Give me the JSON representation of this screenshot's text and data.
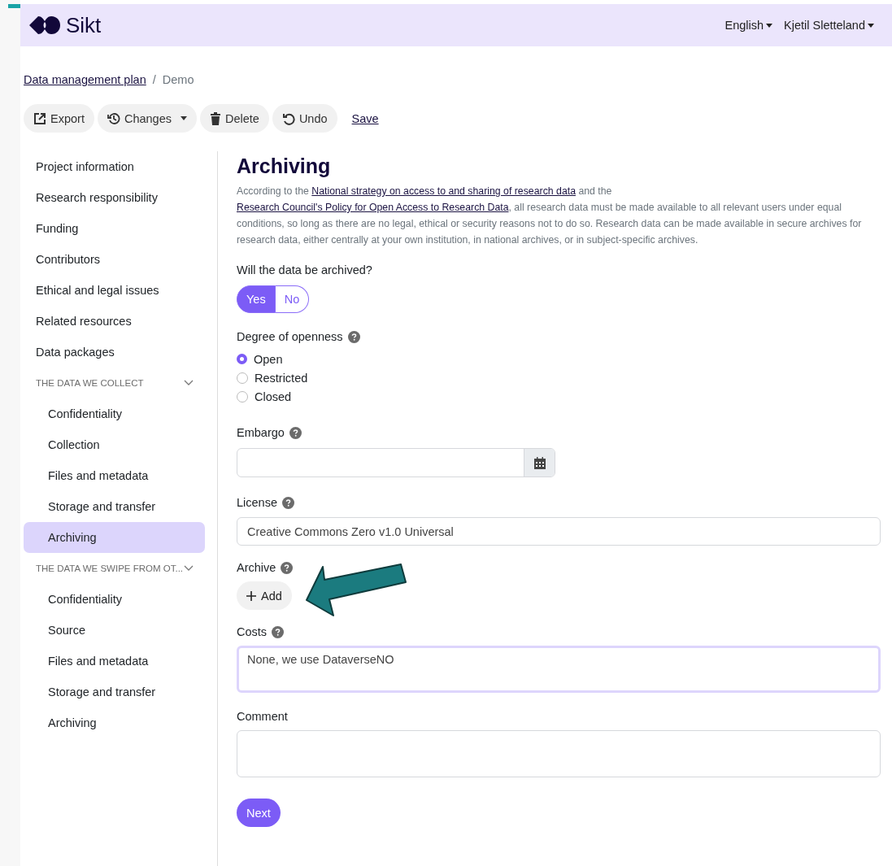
{
  "header": {
    "logo_text": "Sikt",
    "menus": [
      {
        "label": "English"
      },
      {
        "label": "Kjetil Sletteland"
      }
    ]
  },
  "breadcrumb": {
    "link": "Data management plan",
    "separator": "/",
    "current": "Demo"
  },
  "toolbar": [
    {
      "kind": "export",
      "label": "Export",
      "dropdown": false
    },
    {
      "kind": "history",
      "label": "Changes",
      "dropdown": true
    },
    {
      "kind": "trash",
      "label": "Delete",
      "dropdown": false
    },
    {
      "kind": "undo",
      "label": "Undo",
      "dropdown": false
    },
    {
      "kind": "link",
      "label": "Save",
      "dropdown": false
    }
  ],
  "sidebar": {
    "items": [
      {
        "kind": "item",
        "label": "Project information",
        "selected": false
      },
      {
        "kind": "item",
        "label": "Research responsibility",
        "selected": false
      },
      {
        "kind": "item",
        "label": "Funding",
        "selected": false
      },
      {
        "kind": "item",
        "label": "Contributors",
        "selected": false
      },
      {
        "kind": "item",
        "label": "Ethical and legal issues",
        "selected": false
      },
      {
        "kind": "item",
        "label": "Related resources",
        "selected": false
      },
      {
        "kind": "item",
        "label": "Data packages",
        "selected": false
      },
      {
        "kind": "group",
        "label": "THE DATA WE COLLECT",
        "expanded": true,
        "children": [
          {
            "label": "Confidentiality",
            "selected": false
          },
          {
            "label": "Collection",
            "selected": false
          },
          {
            "label": "Files and metadata",
            "selected": false
          },
          {
            "label": "Storage and transfer",
            "selected": false
          },
          {
            "label": "Archiving",
            "selected": true
          }
        ]
      },
      {
        "kind": "group",
        "label": "THE DATA WE SWIPE FROM OT...",
        "expanded": true,
        "children": [
          {
            "label": "Confidentiality",
            "selected": false
          },
          {
            "label": "Source",
            "selected": false
          },
          {
            "label": "Files and metadata",
            "selected": false
          },
          {
            "label": "Storage and transfer",
            "selected": false
          },
          {
            "label": "Archiving",
            "selected": false
          }
        ]
      }
    ]
  },
  "main": {
    "title": "Archiving",
    "intro": [
      {
        "kind": "text",
        "text": "According to the "
      },
      {
        "kind": "link",
        "text": "National strategy on access to and sharing of research data"
      },
      {
        "kind": "text",
        "text": " and the "
      },
      {
        "kind": "link",
        "text": "Research Council's Policy for Open Access to Research Data"
      },
      {
        "kind": "text",
        "text": ", all research data must be made available to all relevant users under equal conditions, so long as there are no legal, ethical or security reasons not to do so. Research data can be made available in secure archives for research data, either centrally at your own institution, in national archives, or in subject-specific archives."
      }
    ],
    "fields": [
      {
        "kind": "toggle",
        "label": "Will the data be archived?",
        "help": false,
        "options": [
          {
            "label": "Yes",
            "selected": true
          },
          {
            "label": "No",
            "selected": false
          }
        ]
      },
      {
        "kind": "radio",
        "label": "Degree of openness",
        "help": true,
        "options": [
          {
            "label": "Open",
            "selected": true
          },
          {
            "label": "Restricted",
            "selected": false
          },
          {
            "label": "Closed",
            "selected": false
          }
        ]
      },
      {
        "kind": "date",
        "label": "Embargo",
        "help": true
      },
      {
        "kind": "text",
        "label": "License",
        "help": true,
        "value": "Creative Commons Zero v1.0 Universal"
      },
      {
        "kind": "add",
        "label": "Archive",
        "help": true,
        "button": "Add",
        "arrow": true
      },
      {
        "kind": "textarea",
        "label": "Costs",
        "help": true,
        "value": "None, we use DataverseNO",
        "focused": true
      },
      {
        "kind": "textarea",
        "label": "Comment",
        "help": false,
        "focused": false
      }
    ],
    "next_button": "Next"
  }
}
